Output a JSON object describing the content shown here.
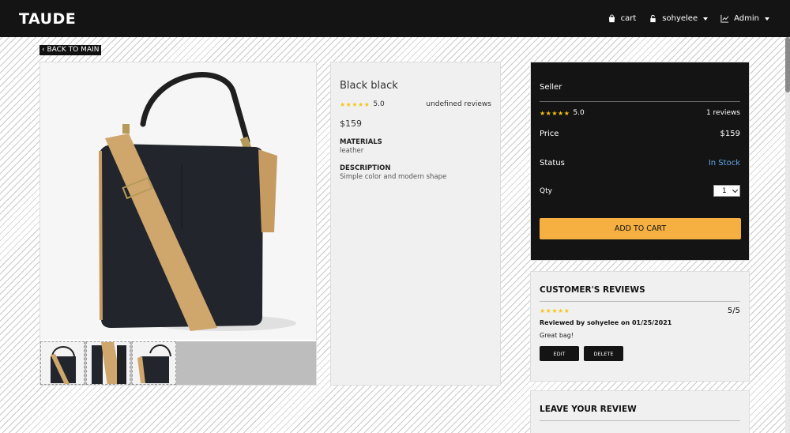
{
  "nav": {
    "brand": "TAUDE",
    "cart_label": "cart",
    "user_label": "sohyelee",
    "admin_label": "Admin",
    "cart_icon": "shopping-bag-icon",
    "user_icon": "lock-icon",
    "admin_icon": "chart-line-icon"
  },
  "back_label": "‹ BACK TO MAIN",
  "product": {
    "name": "Black black",
    "rating": "5.0",
    "stars": "★★★★★",
    "reviews_text": "undefined reviews",
    "price": "$159",
    "materials_title": "MATERIALS",
    "materials_text": "leather",
    "description_title": "DESCRIPTION",
    "description_text": "Simple color and modern shape"
  },
  "seller": {
    "title": "Seller",
    "stars": "★★★★★",
    "rating": "5.0",
    "reviews_count": "1 reviews",
    "price_label": "Price",
    "price_value": "$159",
    "status_label": "Status",
    "status_value": "In Stock",
    "qty_label": "Qty",
    "qty_value": "1",
    "add_to_cart": "ADD TO CART"
  },
  "reviews": {
    "title": "CUSTOMER'S REVIEWS",
    "items": [
      {
        "stars": "★★★★★",
        "score": "5/5",
        "byline": "Reviewed by sohyelee on 01/25/2021",
        "text": "Great bag!",
        "edit_label": "EDIT",
        "delete_label": "DELETE"
      }
    ]
  },
  "leave_review": {
    "title": "LEAVE YOUR REVIEW"
  },
  "colors": {
    "nav_bg": "#141414",
    "accent": "#f5b041",
    "star": "#f5c518",
    "in_stock": "#5fa8e8"
  }
}
